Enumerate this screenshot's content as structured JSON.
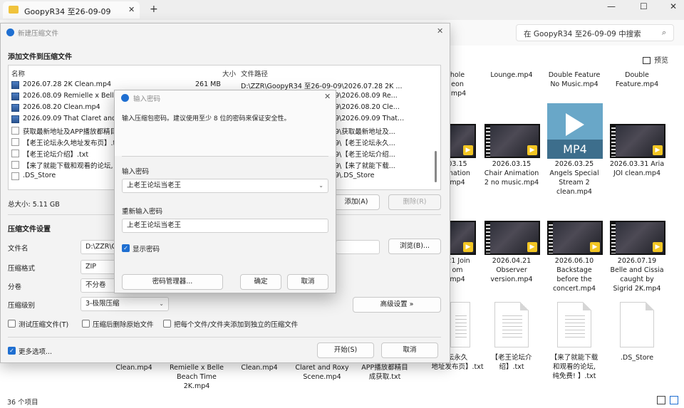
{
  "explorer": {
    "tab_title": "GoopyR34 至26-09-09",
    "search_placeholder": "在 GoopyR34 至26-09-09 中搜索",
    "preview_label": "预览",
    "status": "36 个项目",
    "grid_items": [
      {
        "label": "hole\neon\n.mp4"
      },
      {
        "label": "Lounge.mp4"
      },
      {
        "label": "Double Feature\nNo Music.mp4"
      },
      {
        "label": "Double\nFeature.mp4"
      },
      {
        "label": "03.15\nimation\nmp4"
      },
      {
        "label": "2026.03.15\nChair Animation\n2 no music.mp4"
      },
      {
        "label": "2026.03.25\nAngels Special\nStream 2\nclean.mp4"
      },
      {
        "label": "2026.03.31 Aria\nJOI clean.mp4"
      },
      {
        "label": ".21 Join\nom\nmp4"
      },
      {
        "label": "2026.04.21\nObserver\nversion.mp4"
      },
      {
        "label": "2026.06.10\nBackstage\nbefore the\nconcert.mp4"
      },
      {
        "label": "2026.07.19\nBelle and Cissia\ncaught by\nSigrid 2K.mp4"
      },
      {
        "label": "坛永久\n地址发布页】.txt"
      },
      {
        "label": "【老王论坛介\n绍】.txt"
      },
      {
        "label": "【来了就能下载\n和观看的论坛,\n纯免费! 】.txt"
      },
      {
        "label": ".DS_Store"
      }
    ],
    "bottom_labels": [
      "Clean.mp4",
      "Remielle x Belle\nBeach Time\n2K.mp4",
      "Clean.mp4",
      "Claret and Roxy\nScene.mp4",
      "APP播放都精目\n成获取.txt"
    ],
    "mp4_label": "MP4"
  },
  "archive": {
    "title": "新建压缩文件",
    "section_add": "添加文件到压缩文件",
    "col_name": "名称",
    "col_size": "大小",
    "col_path": "文件路径",
    "files": [
      {
        "name": "2026.07.28 2K Clean.mp4",
        "size": "261 MB",
        "path": "D:\\ZZR\\GoopyR34 至26-09-09\\2026.07.28 2K ...",
        "type": "video"
      },
      {
        "name": "2026.08.09 Remielle x Belle B",
        "size": "",
        "path": "9\\2026.08.09 Re...",
        "type": "video"
      },
      {
        "name": "2026.08.20 Clean.mp4",
        "size": "",
        "path": "9\\2026.08.20 Cle...",
        "type": "video"
      },
      {
        "name": "2026.09.09 That Claret and R",
        "size": "",
        "path": "9\\2026.09.09 That...",
        "type": "video"
      },
      {
        "name": "获取最新地址及APP播放都精目",
        "size": "",
        "path": "9\\获取最新地址及...",
        "type": "text"
      },
      {
        "name": "【老王论坛永久地址发布页】.tx",
        "size": "",
        "path": "9\\【老王论坛永久...",
        "type": "text"
      },
      {
        "name": "【老王论坛介绍】.txt",
        "size": "",
        "path": "9\\【老王论坛介绍...",
        "type": "text"
      },
      {
        "name": "【来了就能下载和观看的论坛,",
        "size": "",
        "path": "9\\【来了就能下载...",
        "type": "text"
      },
      {
        "name": ".DS_Store",
        "size": "",
        "path": "9\\.DS_Store",
        "type": "text"
      }
    ],
    "total_size": "总大小: 5.11 GB",
    "add_button": "添加(A)",
    "delete_button": "删除(R)",
    "section_settings": "压缩文件设置",
    "label_filename": "文件名",
    "filename_value": "D:\\ZZR\\G",
    "browse_button": "浏览(B)...",
    "label_format": "压缩格式",
    "format_value": "ZIP",
    "label_split": "分卷",
    "split_value": "不分卷",
    "label_level": "压缩级别",
    "level_value": "3-极限压缩",
    "advanced_button": "高级设置 »",
    "opt_test": "测试压缩文件(T)",
    "opt_delete_source": "压缩后删除原始文件",
    "opt_separate": "把每个文件/文件夹添加到独立的压缩文件",
    "more_options": "更多选项...",
    "start_button": "开始(S)",
    "cancel_button": "取消"
  },
  "password": {
    "title": "输入密码",
    "hint": "输入压缩包密码。建议使用至少 8 位的密码来保证安全性。",
    "label_enter": "输入密码",
    "enter_value": "上老王论坛当老王",
    "label_reenter": "重新输入密码",
    "reenter_value": "上老王论坛当老王",
    "show_password": "显示密码",
    "manager_button": "密码管理器...",
    "ok_button": "确定",
    "cancel_button": "取消"
  }
}
